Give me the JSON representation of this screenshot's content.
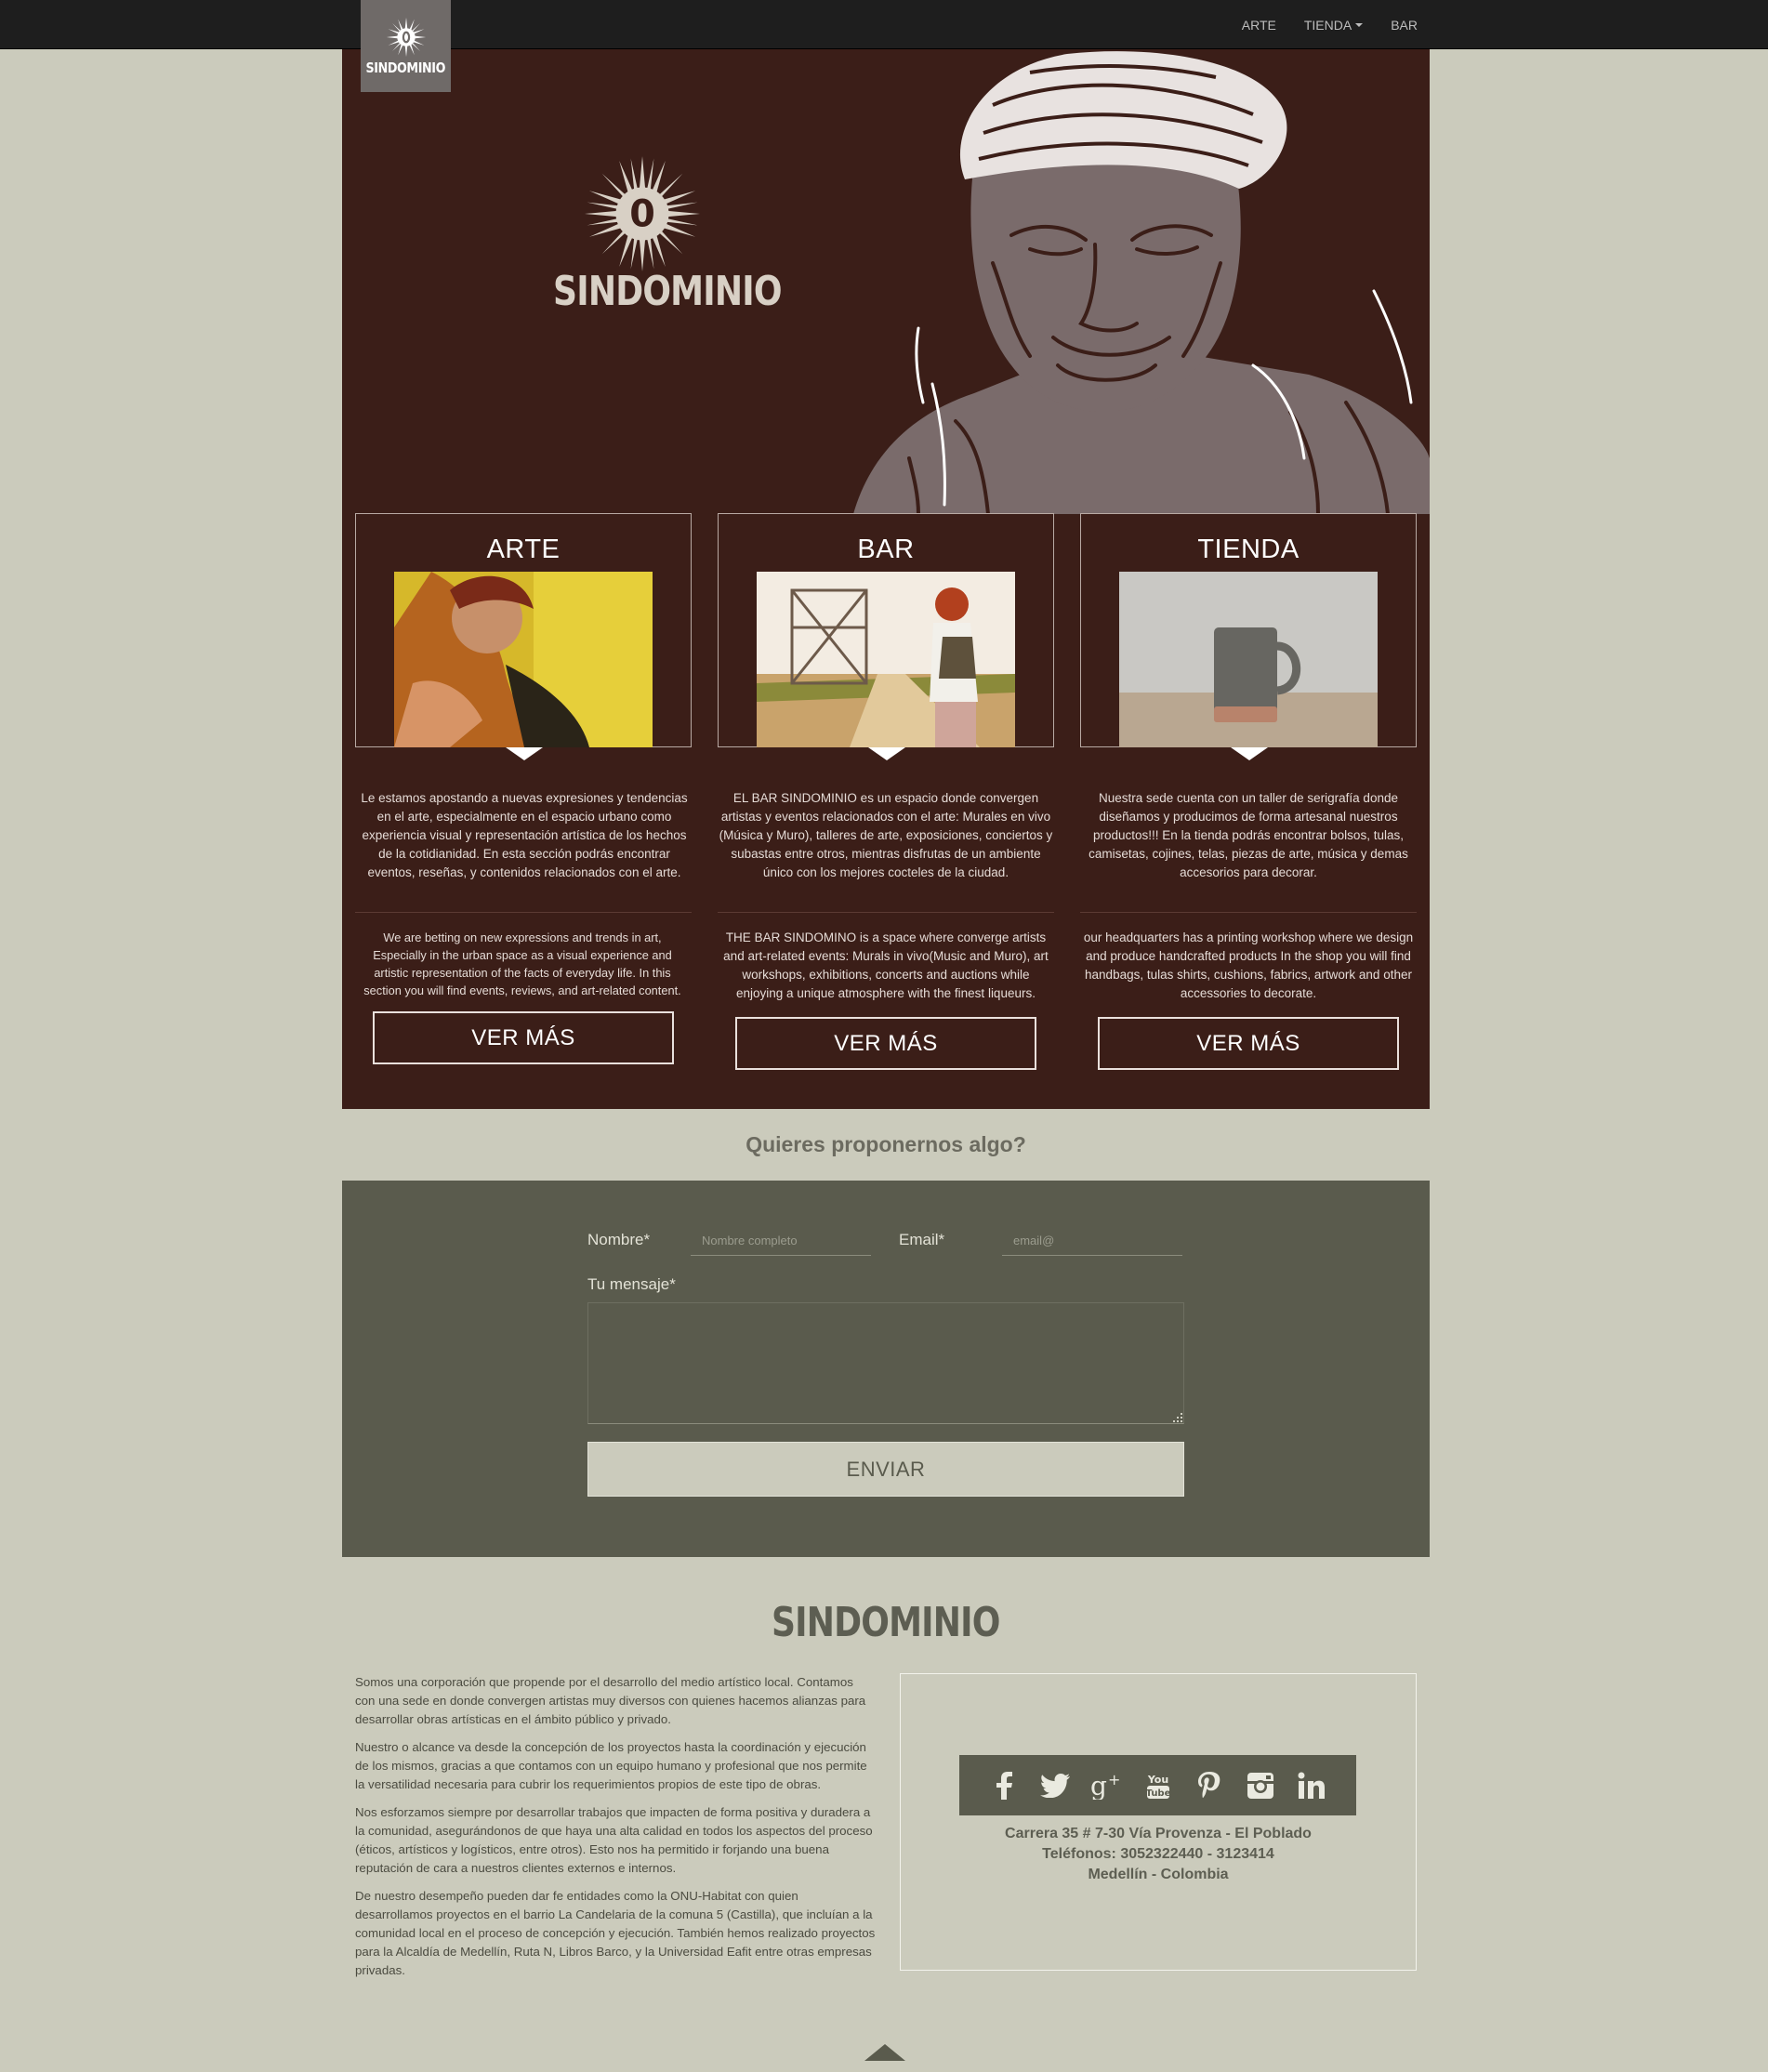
{
  "nav": {
    "brand": "SINDOMINIO",
    "links": [
      {
        "label": "ARTE"
      },
      {
        "label": "TIENDA"
      },
      {
        "label": "BAR"
      }
    ]
  },
  "hero": {
    "brand": "SINDOMINIO",
    "logo_mark": "0"
  },
  "columns": [
    {
      "title": "ARTE",
      "text_es": "Le estamos apostando a nuevas expresiones y tendencias en el arte, especialmente en el espacio urbano como experiencia visual y representación artística de los hechos de la cotidianidad. En esta sección podrás encontrar eventos, reseñas, y contenidos relacionados con el arte.",
      "text_en": "We are betting on new expressions and trends in art, Especially in the urban space as a visual experience and artistic representation of the facts of everyday life. In this section you will find events, reviews, and art-related content.",
      "button": "VER MÁS"
    },
    {
      "title": "BAR",
      "text_es": "EL BAR SINDOMINIO es un espacio donde convergen artistas y eventos relacionados con el arte: Murales en vivo (Música y Muro), talleres de arte, exposiciones, conciertos y subastas entre otros, mientras disfrutas de un ambiente único con los mejores cocteles de la ciudad.",
      "text_en": "THE BAR SINDOMINO is a space where converge artists and art-related events: Murals in vivo(Music and Muro), art workshops, exhibitions, concerts and auctions while enjoying a unique atmosphere with the finest liqueurs.",
      "button": "VER MÁS"
    },
    {
      "title": "TIENDA",
      "text_es": "Nuestra sede cuenta con un taller de serigrafía donde diseñamos y producimos de forma artesanal nuestros productos!!! En la tienda podrás encontrar bolsos, tulas, camisetas, cojines, telas, piezas de arte, música y demas accesorios para decorar.",
      "text_en": "our headquarters has a printing workshop where we design and produce handcrafted products In the shop you will find handbags, tulas shirts, cushions, fabrics, artwork and other accessories to decorate.",
      "button": "VER MÁS"
    }
  ],
  "form": {
    "heading": "Quieres proponernos algo?",
    "name_label": "Nombre*",
    "name_placeholder": "Nombre completo",
    "email_label": "Email*",
    "email_placeholder": "email@",
    "message_label": "Tu mensaje*",
    "submit": "ENVIAR"
  },
  "footer": {
    "title": "SINDOMINIO",
    "paragraphs": [
      "Somos una corporación que propende por el desarrollo del medio artístico local. Contamos con una sede en donde convergen artistas muy diversos con quienes hacemos alianzas para desarrollar obras artísticas en el ámbito público y privado.",
      "Nuestro o alcance va desde la concepción de los proyectos hasta la coordinación y ejecución de los mismos, gracias a que contamos con un equipo humano y profesional que nos permite la versatilidad necesaria para cubrir los requerimientos propios de este tipo de obras.",
      "Nos esforzamos siempre por desarrollar trabajos que impacten de forma positiva y duradera a la comunidad, asegurándonos de que haya una alta calidad en todos los aspectos del proceso (éticos, artísticos y logísticos, entre otros). Esto nos ha permitido ir forjando una buena reputación de cara a nuestros clientes externos e internos.",
      "De nuestro desempeño pueden dar fe entidades como la ONU-Habitat con quien desarrollamos proyectos en el barrio La Candelaria de la comuna 5 (Castilla), que incluían a la comunidad local en el proceso de concepción y ejecución. También hemos realizado proyectos para la Alcaldía de Medellín, Ruta N, Libros Barco, y la Universidad Eafit entre otras empresas privadas."
    ],
    "social": [
      "facebook-icon",
      "twitter-icon",
      "google-plus-icon",
      "youtube-icon",
      "pinterest-icon",
      "instagram-icon",
      "linkedin-icon"
    ],
    "address_lines": [
      "Carrera 35 # 7-30 Vía Provenza - El Poblado",
      "Teléfonos: 3052322440 - 3123414",
      "Medellín - Colombia"
    ]
  },
  "colors": {
    "page_bg": "#cbcbbc",
    "hero_bg": "#3b1e18",
    "form_bg": "#5a5b4d",
    "nav_bg": "#1e1e1e"
  }
}
